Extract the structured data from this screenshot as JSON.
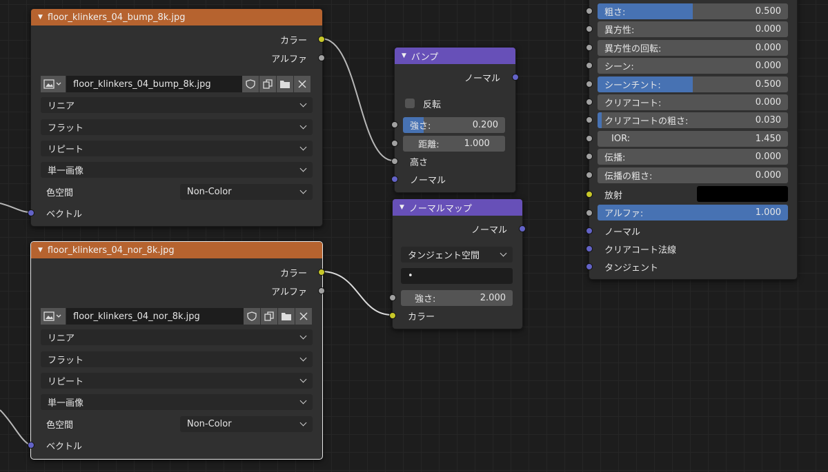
{
  "node_image_bump": {
    "title": "floor_klinkers_04_bump_8k.jpg",
    "out_color": "カラー",
    "out_alpha": "アルファ",
    "image_name": "floor_klinkers_04_bump_8k.jpg",
    "interpolation": "リニア",
    "projection": "フラット",
    "extension": "リピート",
    "source": "単一画像",
    "colorspace_label": "色空間",
    "colorspace_value": "Non-Color",
    "in_vector": "ベクトル"
  },
  "node_image_nor": {
    "title": "floor_klinkers_04_nor_8k.jpg",
    "out_color": "カラー",
    "out_alpha": "アルファ",
    "image_name": "floor_klinkers_04_nor_8k.jpg",
    "interpolation": "リニア",
    "projection": "フラット",
    "extension": "リピート",
    "source": "単一画像",
    "colorspace_label": "色空間",
    "colorspace_value": "Non-Color",
    "in_vector": "ベクトル"
  },
  "node_bump": {
    "title": "バンプ",
    "out_normal": "ノーマル",
    "invert_label": "反転",
    "strength_label": "強さ:",
    "strength_value": "0.200",
    "strength_fraction": 0.2,
    "distance_label": "距離:",
    "distance_value": "1.000",
    "in_height": "高さ",
    "in_normal": "ノーマル"
  },
  "node_normal_map": {
    "title": "ノーマルマップ",
    "out_normal": "ノーマル",
    "space": "タンジェント空間",
    "uv_placeholder": "•",
    "strength_label": "強さ:",
    "strength_value": "2.000",
    "in_color": "カラー"
  },
  "node_principled": {
    "rows": [
      {
        "label": "粗さ:",
        "value": "0.500",
        "fill": 0.5,
        "socket": "gray"
      },
      {
        "label": "異方性:",
        "value": "0.000",
        "fill": 0,
        "socket": "gray"
      },
      {
        "label": "異方性の回転:",
        "value": "0.000",
        "fill": 0,
        "socket": "gray"
      },
      {
        "label": "シーン:",
        "value": "0.000",
        "fill": 0,
        "socket": "gray"
      },
      {
        "label": "シーンチント:",
        "value": "0.500",
        "fill": 0.5,
        "socket": "gray"
      },
      {
        "label": "クリアコート:",
        "value": "0.000",
        "fill": 0,
        "socket": "gray"
      },
      {
        "label": "クリアコートの粗さ:",
        "value": "0.030",
        "fill": 0.03,
        "socket": "gray"
      },
      {
        "label": "IOR:",
        "value": "1.450",
        "fill": 0,
        "socket": "gray"
      },
      {
        "label": "伝播:",
        "value": "0.000",
        "fill": 0,
        "socket": "gray"
      },
      {
        "label": "伝播の粗さ:",
        "value": "0.000",
        "fill": 0,
        "socket": "gray"
      }
    ],
    "emission_label": "放射",
    "emission_color": "#000000",
    "alpha_label": "アルファ:",
    "alpha_value": "1.000",
    "alpha_fill": 1.0,
    "in_normal": "ノーマル",
    "in_clearcoat_normal": "クリアコート法線",
    "in_tangent": "タンジェント"
  },
  "colors": {
    "image_header": "#b6632f",
    "vector_header": "#6750b8",
    "socket_color": "#c7c729",
    "socket_float": "#a1a1a1",
    "socket_vector": "#6363c7",
    "slider_fill": "#4772b3"
  }
}
